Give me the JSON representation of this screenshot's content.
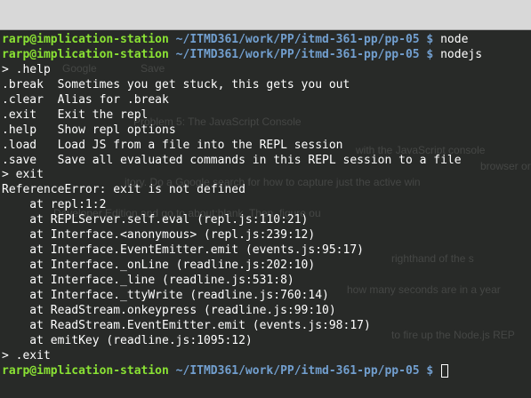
{
  "window": {
    "title": ""
  },
  "background_window": {
    "texts": [
      "Google",
      "Save",
      "Problem 5: The JavaScript Console",
      "with the JavaScript console",
      "browser or",
      "itory. Do a Google search for how to capture just the active win",
      "Developer Edition and go to about:blank. Then, figure ou",
      "righthand of the s",
      "how many seconds are in a year",
      "to fire up the Node.js REP"
    ]
  },
  "terminal": {
    "prompt": {
      "user_host": "rarp@implication-station",
      "path": "~/ITMD361/work/PP/itmd-361-pp/pp-05 $"
    },
    "lines": [
      {
        "type": "prompt",
        "command": "node"
      },
      {
        "type": "prompt",
        "command": "nodejs"
      },
      {
        "type": "text",
        "text": "> .help"
      },
      {
        "type": "text",
        "text": ".break  Sometimes you get stuck, this gets you out"
      },
      {
        "type": "text",
        "text": ".clear  Alias for .break"
      },
      {
        "type": "text",
        "text": ".exit   Exit the repl"
      },
      {
        "type": "text",
        "text": ".help   Show repl options"
      },
      {
        "type": "text",
        "text": ".load   Load JS from a file into the REPL session"
      },
      {
        "type": "text",
        "text": ".save   Save all evaluated commands in this REPL session to a file"
      },
      {
        "type": "text",
        "text": "> exit"
      },
      {
        "type": "text",
        "text": "ReferenceError: exit is not defined"
      },
      {
        "type": "text",
        "text": "    at repl:1:2"
      },
      {
        "type": "text",
        "text": "    at REPLServer.self.eval (repl.js:110:21)"
      },
      {
        "type": "text",
        "text": "    at Interface.<anonymous> (repl.js:239:12)"
      },
      {
        "type": "text",
        "text": "    at Interface.EventEmitter.emit (events.js:95:17)"
      },
      {
        "type": "text",
        "text": "    at Interface._onLine (readline.js:202:10)"
      },
      {
        "type": "text",
        "text": "    at Interface._line (readline.js:531:8)"
      },
      {
        "type": "text",
        "text": "    at Interface._ttyWrite (readline.js:760:14)"
      },
      {
        "type": "text",
        "text": "    at ReadStream.onkeypress (readline.js:99:10)"
      },
      {
        "type": "text",
        "text": "    at ReadStream.EventEmitter.emit (events.js:98:17)"
      },
      {
        "type": "text",
        "text": "    at emitKey (readline.js:1095:12)"
      },
      {
        "type": "text",
        "text": "> .exit"
      },
      {
        "type": "prompt",
        "command": ""
      }
    ]
  },
  "colors": {
    "user_host": "#8ae234",
    "path": "#729fcf",
    "text": "#ffffff",
    "background": "#2b2e2b"
  }
}
